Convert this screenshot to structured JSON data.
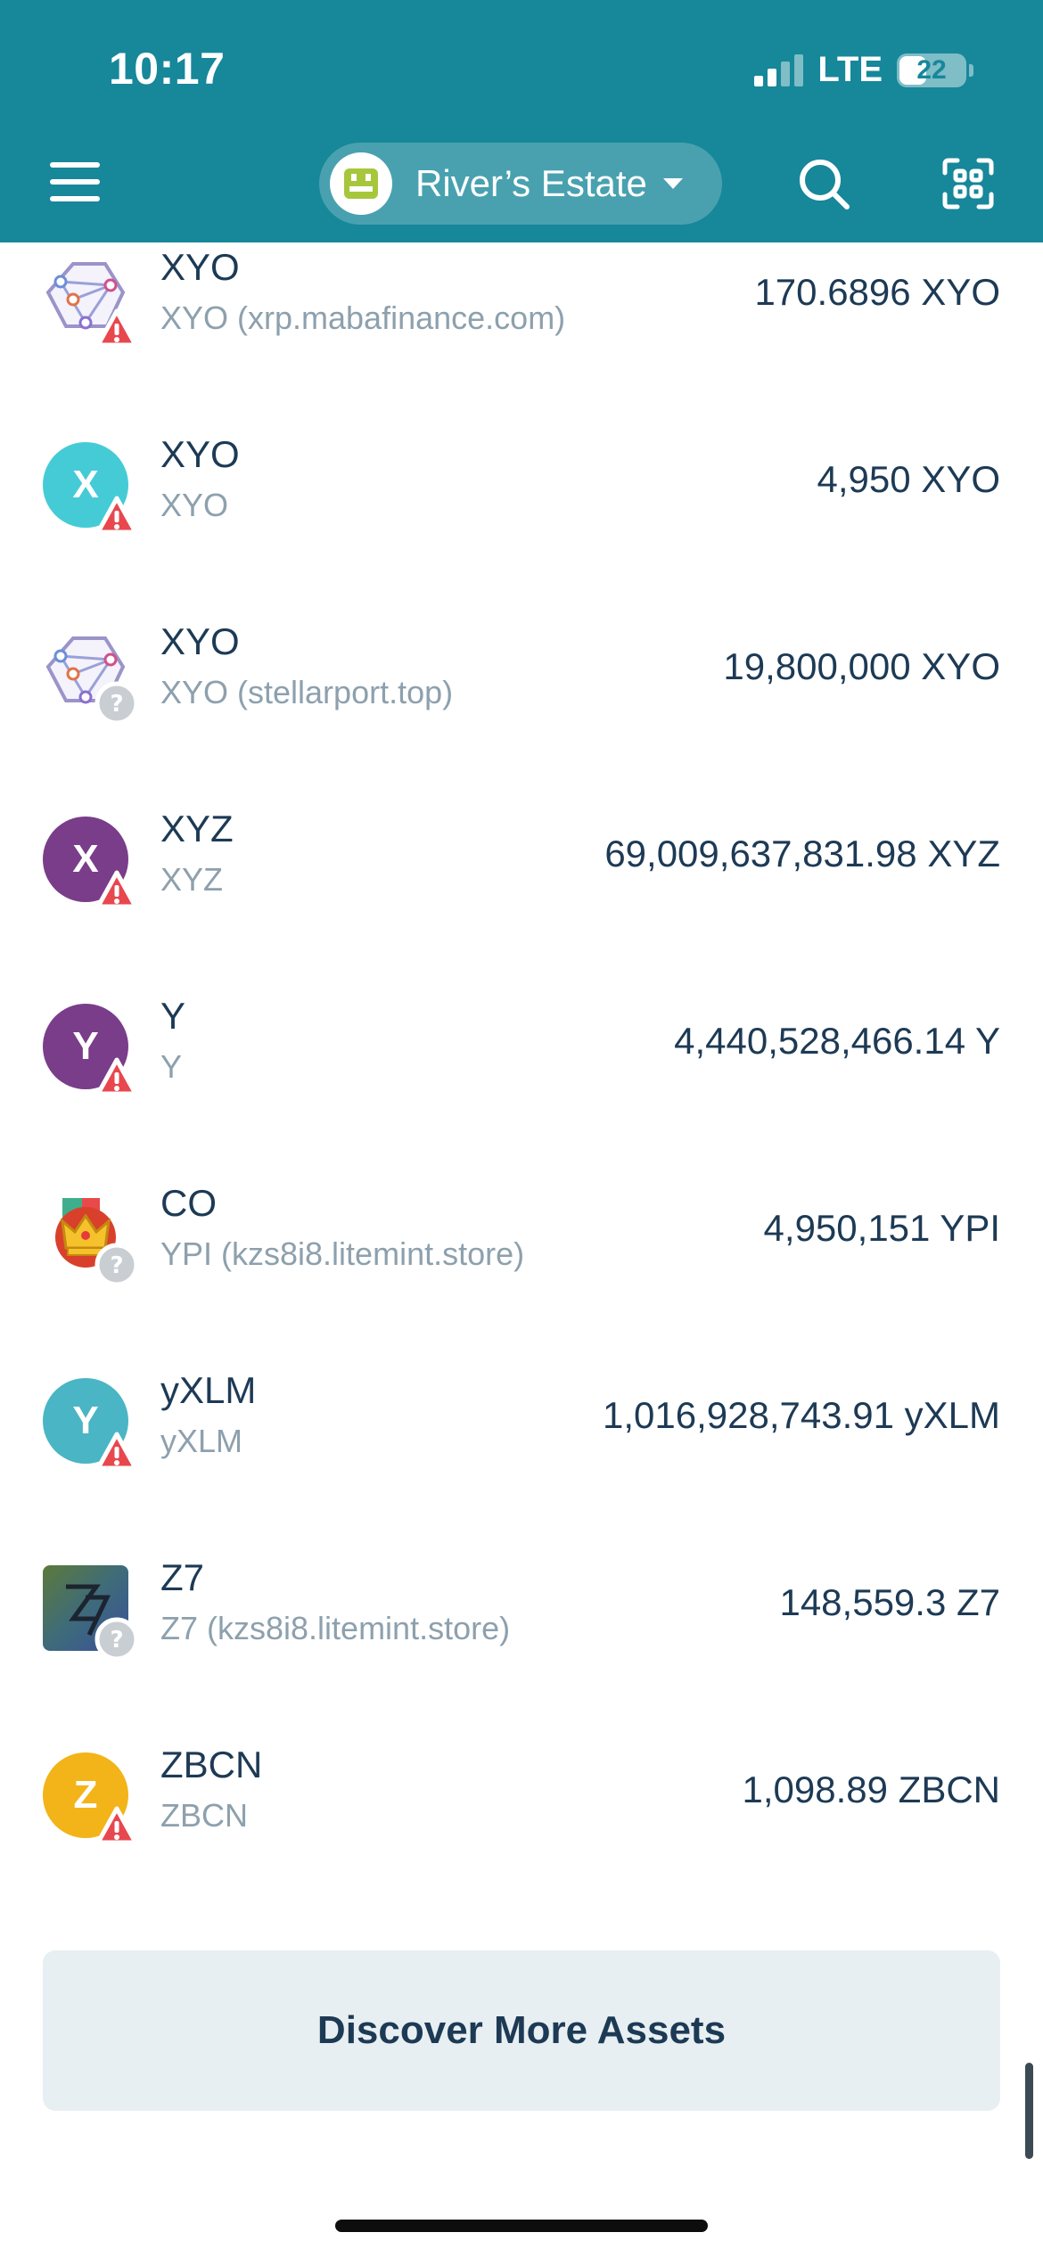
{
  "status_bar": {
    "time": "10:17",
    "network": "LTE",
    "battery": "22"
  },
  "header": {
    "wallet_name": "River’s Estate"
  },
  "colors": {
    "header_bg": "#17879a",
    "warning": "#e8474e",
    "unknown": "#c9ced3"
  },
  "assets": [
    {
      "name": "XYO",
      "sub": "XYO (xrp.mabafinance.com)",
      "amount": "170.6896 XYO",
      "icon": "xyo-network-icon",
      "badge": "warning"
    },
    {
      "name": "XYO",
      "sub": "XYO",
      "amount": "4,950 XYO",
      "icon": "letter-x-icon",
      "letter": "X",
      "badge": "warning"
    },
    {
      "name": "XYO",
      "sub": "XYO (stellarport.top)",
      "amount": "19,800,000 XYO",
      "icon": "xyo-network-icon",
      "badge": "unknown"
    },
    {
      "name": "XYZ",
      "sub": "XYZ",
      "amount": "69,009,637,831.98 XYZ",
      "icon": "letter-x-icon",
      "letter": "X",
      "badge": "warning"
    },
    {
      "name": "Y",
      "sub": "Y",
      "amount": "4,440,528,466.14 Y",
      "icon": "letter-y-icon",
      "letter": "Y",
      "badge": "warning"
    },
    {
      "name": "CO",
      "sub": "YPI (kzs8i8.litemint.store)",
      "amount": "4,950,151 YPI",
      "icon": "crown-icon",
      "badge": "unknown"
    },
    {
      "name": "yXLM",
      "sub": "yXLM",
      "amount": "1,016,928,743.91 yXLM",
      "icon": "letter-y-icon",
      "letter": "Y",
      "badge": "warning"
    },
    {
      "name": "Z7",
      "sub": "Z7 (kzs8i8.litemint.store)",
      "amount": "148,559.3 Z7",
      "icon": "z7-logo-icon",
      "badge": "unknown"
    },
    {
      "name": "ZBCN",
      "sub": "ZBCN",
      "amount": "1,098.89 ZBCN",
      "icon": "letter-z-icon",
      "letter": "Z",
      "badge": "warning"
    }
  ],
  "discover_button": "Discover More Assets"
}
